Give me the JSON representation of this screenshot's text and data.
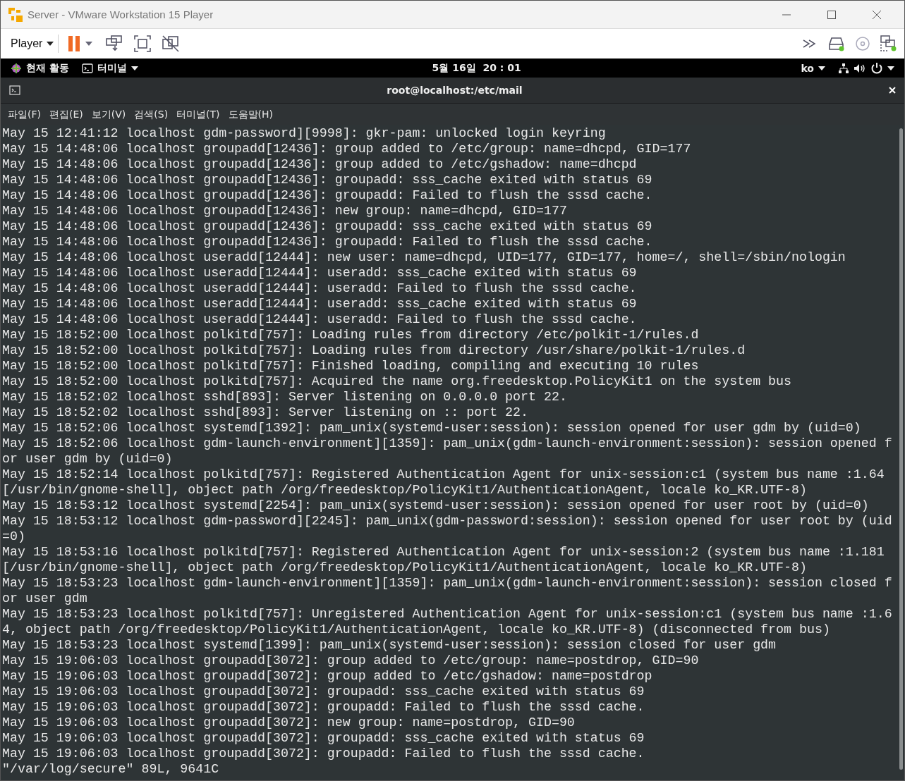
{
  "window": {
    "title": "Server - VMware Workstation 15 Player"
  },
  "toolbar": {
    "menu_label": "Player"
  },
  "top_bar": {
    "activities": "현재 활동",
    "app_menu": "터미널",
    "clock": "5월 16일  20 : 01",
    "input_method": "ko"
  },
  "terminal": {
    "title": "root@localhost:/etc/mail",
    "menu": [
      "파일(F)",
      "편집(E)",
      "보기(V)",
      "검색(S)",
      "터미널(T)",
      "도움말(H)"
    ],
    "lines": [
      "May 15 12:41:12 localhost gdm-password][9998]: gkr-pam: unlocked login keyring",
      "May 15 14:48:06 localhost groupadd[12436]: group added to /etc/group: name=dhcpd, GID=177",
      "May 15 14:48:06 localhost groupadd[12436]: group added to /etc/gshadow: name=dhcpd",
      "May 15 14:48:06 localhost groupadd[12436]: groupadd: sss_cache exited with status 69",
      "May 15 14:48:06 localhost groupadd[12436]: groupadd: Failed to flush the sssd cache.",
      "May 15 14:48:06 localhost groupadd[12436]: new group: name=dhcpd, GID=177",
      "May 15 14:48:06 localhost groupadd[12436]: groupadd: sss_cache exited with status 69",
      "May 15 14:48:06 localhost groupadd[12436]: groupadd: Failed to flush the sssd cache.",
      "May 15 14:48:06 localhost useradd[12444]: new user: name=dhcpd, UID=177, GID=177, home=/, shell=/sbin/nologin",
      "May 15 14:48:06 localhost useradd[12444]: useradd: sss_cache exited with status 69",
      "May 15 14:48:06 localhost useradd[12444]: useradd: Failed to flush the sssd cache.",
      "May 15 14:48:06 localhost useradd[12444]: useradd: sss_cache exited with status 69",
      "May 15 14:48:06 localhost useradd[12444]: useradd: Failed to flush the sssd cache.",
      "May 15 18:52:00 localhost polkitd[757]: Loading rules from directory /etc/polkit-1/rules.d",
      "May 15 18:52:00 localhost polkitd[757]: Loading rules from directory /usr/share/polkit-1/rules.d",
      "May 15 18:52:00 localhost polkitd[757]: Finished loading, compiling and executing 10 rules",
      "May 15 18:52:00 localhost polkitd[757]: Acquired the name org.freedesktop.PolicyKit1 on the system bus",
      "May 15 18:52:02 localhost sshd[893]: Server listening on 0.0.0.0 port 22.",
      "May 15 18:52:02 localhost sshd[893]: Server listening on :: port 22.",
      "May 15 18:52:06 localhost systemd[1392]: pam_unix(systemd-user:session): session opened for user gdm by (uid=0)",
      "May 15 18:52:06 localhost gdm-launch-environment][1359]: pam_unix(gdm-launch-environment:session): session opened f",
      "or user gdm by (uid=0)",
      "May 15 18:52:14 localhost polkitd[757]: Registered Authentication Agent for unix-session:c1 (system bus name :1.64",
      "[/usr/bin/gnome-shell], object path /org/freedesktop/PolicyKit1/AuthenticationAgent, locale ko_KR.UTF-8)",
      "May 15 18:53:12 localhost systemd[2254]: pam_unix(systemd-user:session): session opened for user root by (uid=0)",
      "May 15 18:53:12 localhost gdm-password][2245]: pam_unix(gdm-password:session): session opened for user root by (uid",
      "=0)",
      "May 15 18:53:16 localhost polkitd[757]: Registered Authentication Agent for unix-session:2 (system bus name :1.181",
      "[/usr/bin/gnome-shell], object path /org/freedesktop/PolicyKit1/AuthenticationAgent, locale ko_KR.UTF-8)",
      "May 15 18:53:23 localhost gdm-launch-environment][1359]: pam_unix(gdm-launch-environment:session): session closed f",
      "or user gdm",
      "May 15 18:53:23 localhost polkitd[757]: Unregistered Authentication Agent for unix-session:c1 (system bus name :1.6",
      "4, object path /org/freedesktop/PolicyKit1/AuthenticationAgent, locale ko_KR.UTF-8) (disconnected from bus)",
      "May 15 18:53:23 localhost systemd[1399]: pam_unix(systemd-user:session): session closed for user gdm",
      "May 15 19:06:03 localhost groupadd[3072]: group added to /etc/group: name=postdrop, GID=90",
      "May 15 19:06:03 localhost groupadd[3072]: group added to /etc/gshadow: name=postdrop",
      "May 15 19:06:03 localhost groupadd[3072]: groupadd: sss_cache exited with status 69",
      "May 15 19:06:03 localhost groupadd[3072]: groupadd: Failed to flush the sssd cache.",
      "May 15 19:06:03 localhost groupadd[3072]: new group: name=postdrop, GID=90",
      "May 15 19:06:03 localhost groupadd[3072]: groupadd: sss_cache exited with status 69",
      "May 15 19:06:03 localhost groupadd[3072]: groupadd: Failed to flush the sssd cache."
    ],
    "status_line": "\"/var/log/secure\" 89L, 9641C"
  }
}
